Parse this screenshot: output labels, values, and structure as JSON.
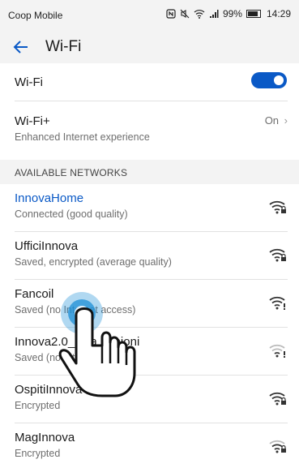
{
  "status_bar": {
    "carrier": "Coop Mobile",
    "battery": "99%",
    "time": "14:29"
  },
  "toolbar": {
    "title": "Wi-Fi"
  },
  "wifi_toggle": {
    "label": "Wi-Fi",
    "state": "on"
  },
  "wifi_plus": {
    "label": "Wi-Fi+",
    "description": "Enhanced Internet experience",
    "value": "On"
  },
  "networks_header": "AVAILABLE NETWORKS",
  "networks": [
    {
      "name": "InnovaHome",
      "status": "Connected (good quality)",
      "connected": true,
      "signal_icon": "wifi-locked-full-icon"
    },
    {
      "name": "UfficiInnova",
      "status": "Saved, encrypted (average quality)",
      "connected": false,
      "signal_icon": "wifi-locked-full-icon"
    },
    {
      "name": "Fancoil",
      "status": "Saved (no Internet access)",
      "connected": false,
      "signal_icon": "wifi-no-internet-icon"
    },
    {
      "name": "Innova2.0_sala riunioni",
      "status": "Saved (no Internet access)",
      "connected": false,
      "signal_icon": "wifi-no-internet-icon"
    },
    {
      "name": "OspitiInnova",
      "status": "Encrypted",
      "connected": false,
      "signal_icon": "wifi-locked-full-icon"
    },
    {
      "name": "MagInnova",
      "status": "Encrypted",
      "connected": false,
      "signal_icon": "wifi-locked-icon"
    }
  ],
  "colors": {
    "accent": "#0a59c6",
    "header_bg": "#f3f3f3",
    "secondary_text": "#6e6e6e",
    "tap_indicator": "#1e8fd6"
  }
}
